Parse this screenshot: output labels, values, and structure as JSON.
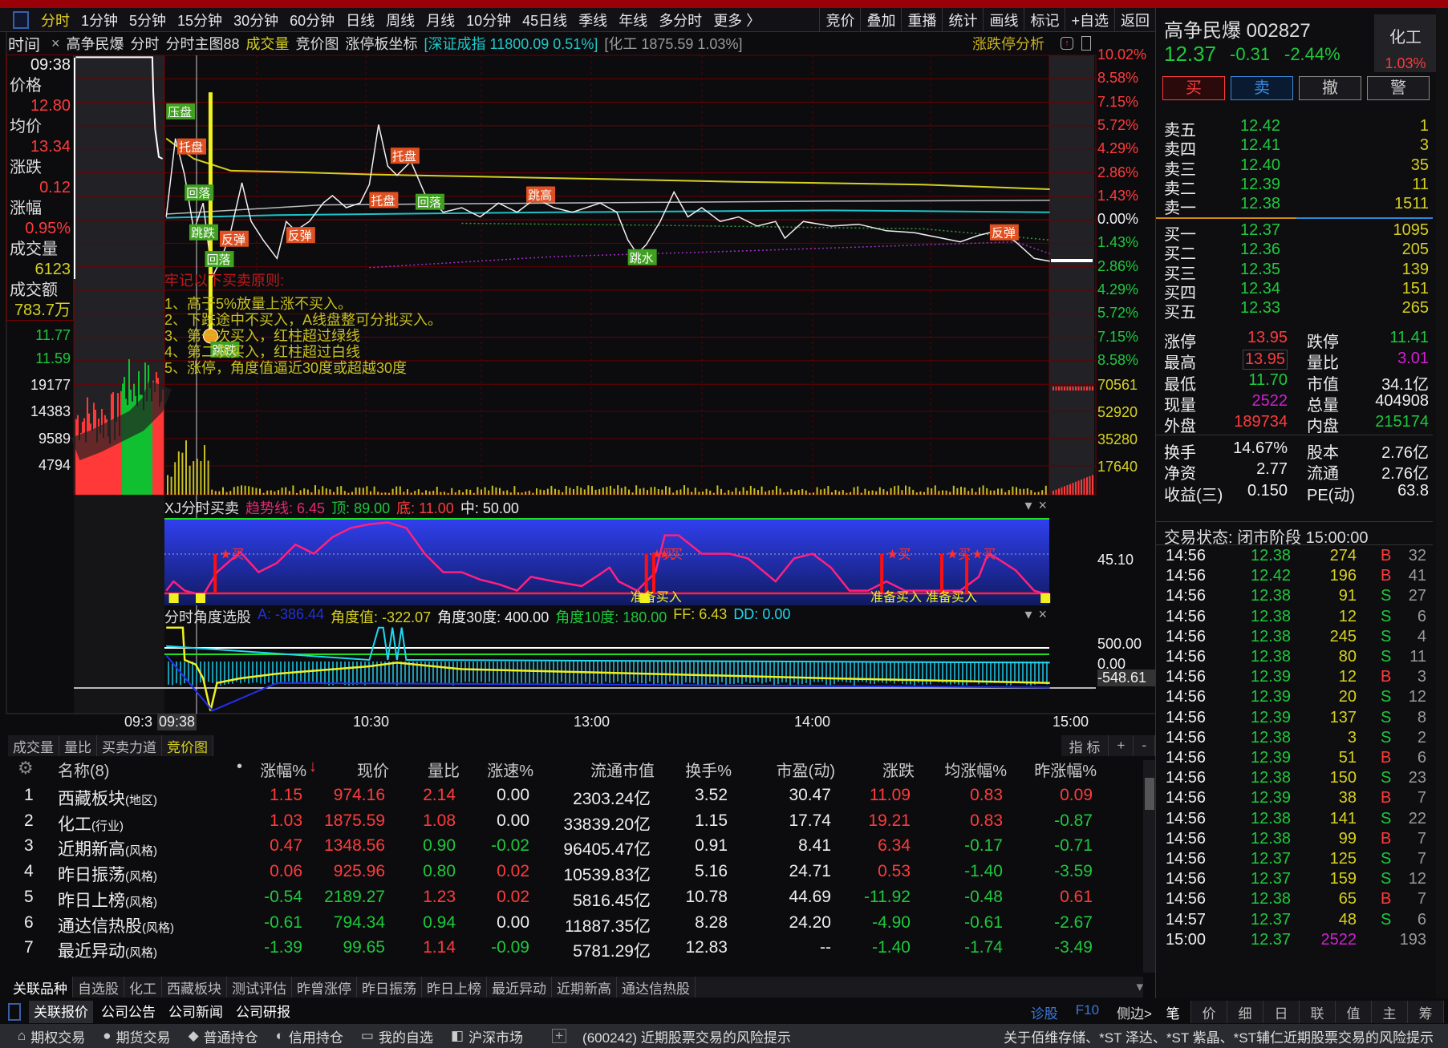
{
  "toolbar": {
    "periods": [
      "分时",
      "1分钟",
      "5分钟",
      "15分钟",
      "30分钟",
      "60分钟",
      "日线",
      "周线",
      "月线",
      "10分钟",
      "45日线",
      "季线",
      "年线",
      "多分时",
      "更多 〉"
    ],
    "active": 0,
    "right": [
      "竞价",
      "叠加",
      "重播",
      "统计",
      "画线",
      "标记",
      "+自选",
      "返回"
    ]
  },
  "chart_header": {
    "time_label": "时间",
    "close": "×",
    "stock": "高争民爆",
    "mode": "分时",
    "main": "分时主图88",
    "volume": "成交量",
    "auction": "竞价图",
    "limit": "涨停板坐标",
    "index": "[深证成指 11800.09 0.51%]",
    "sector": "[化工 1875.59 1.03%]",
    "analysis": "涨跌停分析"
  },
  "cursor_info": {
    "time": "09:38",
    "price_label": "价格",
    "price": "12.80",
    "avg_label": "均价",
    "avg": "13.34",
    "chg_label": "涨跌",
    "chg": "0.12",
    "pct_label": "涨幅",
    "pct": "0.95%",
    "vol_label": "成交量",
    "vol": "6123",
    "amt_label": "成交额",
    "amt": "783.7万"
  },
  "left_axis": {
    "prices": [
      "11.77",
      "11.59"
    ],
    "volume": [
      "19177",
      "14383",
      "9589",
      "4794"
    ]
  },
  "right_axis": {
    "up": [
      "10.02%",
      "8.58%",
      "7.15%",
      "5.72%",
      "4.29%",
      "2.86%",
      "1.43%"
    ],
    "zero": "0.00%",
    "down": [
      "1.43%",
      "2.86%",
      "4.29%",
      "5.72%",
      "7.15%",
      "8.58%"
    ],
    "volume": [
      "70561",
      "52920",
      "35280",
      "17640"
    ],
    "xj": "45.10",
    "angle": [
      "500.00",
      "0.00",
      "-548.61"
    ]
  },
  "time_axis": [
    "09:3",
    "09:38",
    "10:30",
    "13:00",
    "14:00",
    "15:00"
  ],
  "annotations": [
    "压盘",
    "托盘",
    "回落",
    "跳跌",
    "反弹",
    "回落",
    "反弹",
    "托盘",
    "托盘",
    "回落",
    "跳高",
    "跳水",
    "反弹",
    "跳跌"
  ],
  "rules": {
    "title": "牢记以下买卖原则:",
    "items": [
      "1、高于5%放量上涨不买入。",
      "2、下跌途中不买入，A线盘整可分批买入。",
      "3、第一次买入，红柱超过绿线",
      "4、第二次买入，红柱超过白线",
      "5、涨停，角度值逼近30度或超越30度"
    ]
  },
  "xj": {
    "name": "XJ分时买卖",
    "trend": "趋势线: 6.45",
    "top": "顶: 89.00",
    "bottom": "底: 11.00",
    "mid": "中: 50.00",
    "buy": "★买",
    "ready": "准备买入"
  },
  "angle": {
    "name": "分时角度选股",
    "a": "A: -386.44",
    "val": "角度值: -322.07",
    "d30": "角度30度: 400.00",
    "d10": "角度10度: 180.00",
    "ff": "FF: 6.43",
    "dd": "DD: 0.00"
  },
  "sub_tabs": [
    "成交量",
    "量比",
    "买卖力道",
    "竞价图"
  ],
  "sub_tabs_active": 3,
  "sub_right": [
    "指 标",
    "+",
    "-"
  ],
  "table": {
    "headers": [
      "名称(8)",
      "涨幅%",
      "现价",
      "量比",
      "涨速%",
      "流通市值",
      "换手%",
      "市盈(动)",
      "涨跌",
      "均涨幅%",
      "昨涨幅%"
    ],
    "rows": [
      [
        "1",
        "西藏板块",
        "(地区)",
        "1.15",
        "974.16",
        "2.14",
        "0.00",
        "2303.24亿",
        "3.52",
        "30.47",
        "11.09",
        "0.83",
        "0.09"
      ],
      [
        "2",
        "化工",
        "(行业)",
        "1.03",
        "1875.59",
        "1.08",
        "0.00",
        "33839.20亿",
        "1.15",
        "17.74",
        "19.21",
        "0.83",
        "-0.87"
      ],
      [
        "3",
        "近期新高",
        "(风格)",
        "0.47",
        "1348.56",
        "0.90",
        "-0.02",
        "96405.47亿",
        "0.91",
        "8.41",
        "6.34",
        "-0.17",
        "-0.71"
      ],
      [
        "4",
        "昨日振荡",
        "(风格)",
        "0.06",
        "925.96",
        "0.80",
        "0.02",
        "10539.83亿",
        "5.16",
        "24.71",
        "0.53",
        "-1.40",
        "-3.59"
      ],
      [
        "5",
        "昨日上榜",
        "(风格)",
        "-0.54",
        "2189.27",
        "1.23",
        "0.02",
        "5816.45亿",
        "10.78",
        "44.69",
        "-11.92",
        "-0.48",
        "0.61"
      ],
      [
        "6",
        "通达信热股",
        "(风格)",
        "-0.61",
        "794.34",
        "0.94",
        "0.00",
        "11887.35亿",
        "8.28",
        "24.20",
        "-4.90",
        "-0.61",
        "-2.67"
      ],
      [
        "7",
        "最近异动",
        "(风格)",
        "-1.39",
        "99.65",
        "1.14",
        "-0.09",
        "5781.29亿",
        "12.83",
        "--",
        "-1.40",
        "-1.74",
        "-3.49"
      ]
    ]
  },
  "bottom_tabs": [
    "关联品种",
    "自选股",
    "化工",
    "西藏板块",
    "测试评估",
    "昨曾涨停",
    "昨日振荡",
    "昨日上榜",
    "最近异动",
    "近期新高",
    "通达信热股"
  ],
  "bottom_tabs2": [
    "关联报价",
    "公司公告",
    "公司新闻",
    "公司研报"
  ],
  "bottom_links": [
    "诊股",
    "F10",
    "侧边>"
  ],
  "quote": {
    "name": "高争民爆 002827",
    "price": "12.37",
    "chg": "-0.31",
    "pct": "-2.44%",
    "sector": "化工",
    "sector_pct": "1.03%",
    "buttons": [
      "买",
      "卖",
      "撤",
      "警"
    ],
    "asks": [
      [
        "卖五",
        "12.42",
        "1"
      ],
      [
        "卖四",
        "12.41",
        "3"
      ],
      [
        "卖三",
        "12.40",
        "35"
      ],
      [
        "卖二",
        "12.39",
        "11"
      ],
      [
        "卖一",
        "12.38",
        "1511"
      ]
    ],
    "bids": [
      [
        "买一",
        "12.37",
        "1095"
      ],
      [
        "买二",
        "12.36",
        "205"
      ],
      [
        "买三",
        "12.35",
        "139"
      ],
      [
        "买四",
        "12.34",
        "151"
      ],
      [
        "买五",
        "12.33",
        "265"
      ]
    ],
    "stats": [
      [
        "涨停",
        "13.95",
        "跌停",
        "11.41"
      ],
      [
        "最高",
        "13.95",
        "量比",
        "3.01"
      ],
      [
        "最低",
        "11.70",
        "市值",
        "34.1亿"
      ],
      [
        "现量",
        "2522",
        "总量",
        "404908"
      ],
      [
        "外盘",
        "189734",
        "内盘",
        "215174"
      ]
    ],
    "stats2": [
      [
        "换手",
        "14.67%",
        "股本",
        "2.76亿"
      ],
      [
        "净资",
        "2.77",
        "流通",
        "2.76亿"
      ],
      [
        "收益(三)",
        "0.150",
        "PE(动)",
        "63.8"
      ]
    ],
    "status": "交易状态: 闭市阶段 15:00:00",
    "ticks": [
      [
        "14:56",
        "12.38",
        "274",
        "B",
        "32"
      ],
      [
        "14:56",
        "12.42",
        "196",
        "B",
        "41"
      ],
      [
        "14:56",
        "12.38",
        "91",
        "S",
        "27"
      ],
      [
        "14:56",
        "12.38",
        "12",
        "S",
        "6"
      ],
      [
        "14:56",
        "12.38",
        "245",
        "S",
        "4"
      ],
      [
        "14:56",
        "12.38",
        "80",
        "S",
        "11"
      ],
      [
        "14:56",
        "12.39",
        "12",
        "B",
        "3"
      ],
      [
        "14:56",
        "12.39",
        "20",
        "S",
        "12"
      ],
      [
        "14:56",
        "12.39",
        "137",
        "S",
        "8"
      ],
      [
        "14:56",
        "12.38",
        "3",
        "S",
        "2"
      ],
      [
        "14:56",
        "12.39",
        "51",
        "B",
        "6"
      ],
      [
        "14:56",
        "12.38",
        "150",
        "S",
        "23"
      ],
      [
        "14:56",
        "12.39",
        "38",
        "B",
        "7"
      ],
      [
        "14:56",
        "12.38",
        "141",
        "S",
        "22"
      ],
      [
        "14:56",
        "12.38",
        "99",
        "B",
        "7"
      ],
      [
        "14:56",
        "12.37",
        "125",
        "S",
        "7"
      ],
      [
        "14:56",
        "12.37",
        "159",
        "S",
        "12"
      ],
      [
        "14:56",
        "12.38",
        "65",
        "B",
        "7"
      ],
      [
        "14:57",
        "12.37",
        "48",
        "S",
        "6"
      ],
      [
        "15:00",
        "12.37",
        "2522",
        "",
        "193"
      ]
    ],
    "tabs": [
      "笔",
      "价",
      "细",
      "日",
      "联",
      "值",
      "主",
      "筹"
    ]
  },
  "statusbar": {
    "items": [
      "期权交易",
      "期货交易",
      "普通持仓",
      "信用持仓",
      "我的自选",
      "沪深市场"
    ],
    "news1": "(600242) 近期股票交易的风险提示",
    "news2": "关于佰维存储、*ST 泽达、*ST 紫晶、*ST辅仁近期股票交易的风险提示"
  },
  "colors": {
    "up": "#ff3b3b",
    "down": "#1ec83c",
    "vol": "#d6d020",
    "accent": "#e8d020"
  }
}
